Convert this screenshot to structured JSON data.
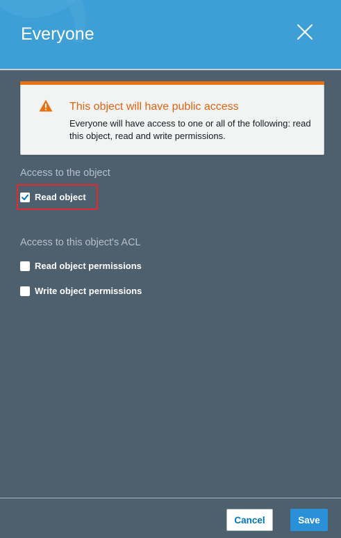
{
  "dialog": {
    "title": "Everyone"
  },
  "alert": {
    "title": "This object will have public access",
    "body": "Everyone will have access to one or all of the following: read this object, read and write permissions."
  },
  "object_access": {
    "label": "Access to the object",
    "options": [
      {
        "label": "Read object",
        "checked": true
      }
    ]
  },
  "acl_access": {
    "label": "Access to this object's ACL",
    "options": [
      {
        "label": "Read object permissions",
        "checked": false
      },
      {
        "label": "Write object permissions",
        "checked": false
      }
    ]
  },
  "footer": {
    "cancel_label": "Cancel",
    "save_label": "Save"
  },
  "colors": {
    "header": "#3e9fd6",
    "body": "#4e5f6e",
    "warning": "#ec7211",
    "primary": "#2a90d8",
    "highlight": "#e8262b"
  }
}
